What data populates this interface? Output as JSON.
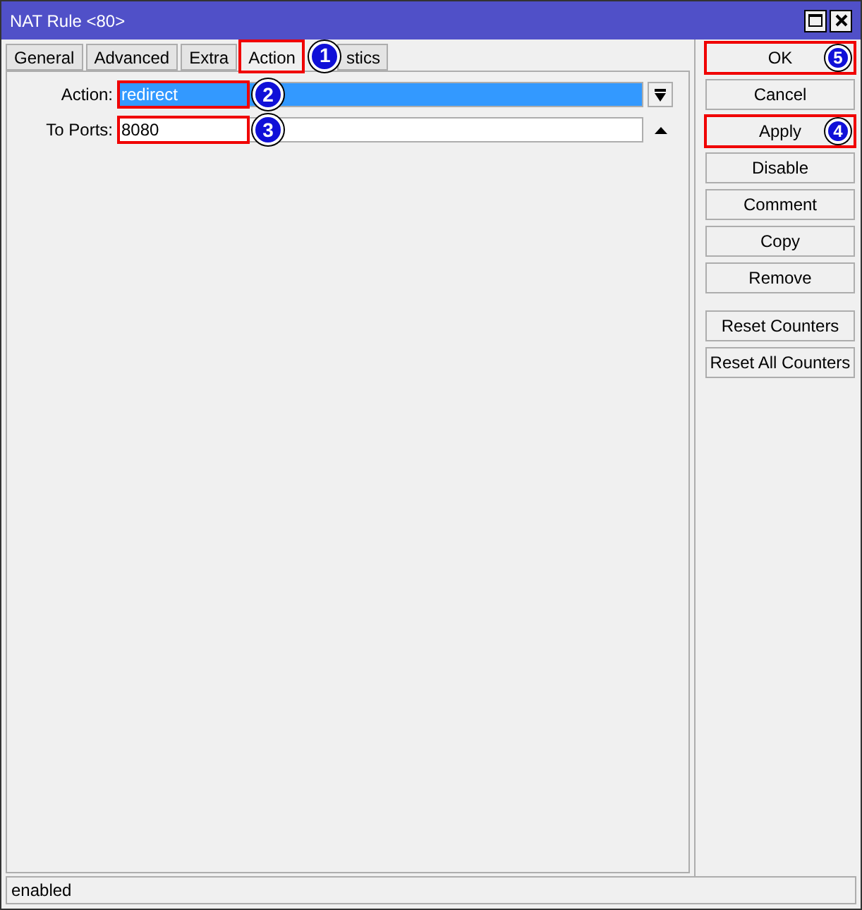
{
  "window": {
    "title": "NAT Rule <80>"
  },
  "tabs": [
    {
      "label": "General",
      "selected": false
    },
    {
      "label": "Advanced",
      "selected": false
    },
    {
      "label": "Extra",
      "selected": false
    },
    {
      "label": "Action",
      "selected": true,
      "callout": "1"
    },
    {
      "label": "stics",
      "selected": false
    }
  ],
  "fields": [
    {
      "kind": "dropdown",
      "label": "Action:",
      "value": "redirect",
      "focused": true,
      "callout": "2"
    },
    {
      "kind": "text",
      "label": "To Ports:",
      "value": "8080",
      "focused": false,
      "callout": "3"
    }
  ],
  "button_groups": [
    [
      {
        "label": "OK",
        "callout": "5"
      },
      {
        "label": "Cancel"
      },
      {
        "label": "Apply",
        "callout": "4"
      },
      {
        "label": "Disable"
      },
      {
        "label": "Comment"
      },
      {
        "label": "Copy"
      },
      {
        "label": "Remove"
      }
    ],
    [
      {
        "label": "Reset Counters"
      },
      {
        "label": "Reset All Counters"
      }
    ]
  ],
  "status_bar": "enabled"
}
